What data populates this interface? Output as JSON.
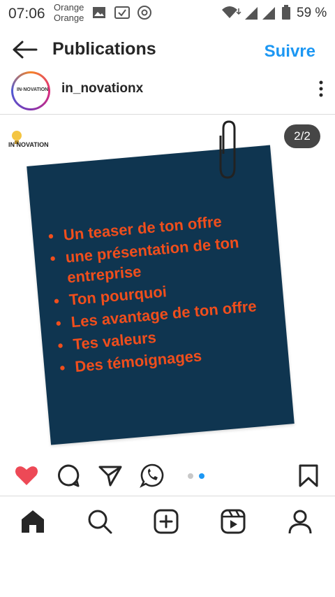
{
  "status_bar": {
    "time": "07:06",
    "carrier_line1": "Orange",
    "carrier_line2": "Orange",
    "battery": "59 %"
  },
  "header": {
    "title": "Publications",
    "follow_label": "Suivre"
  },
  "account": {
    "username": "in_novationx",
    "avatar_text": "IN·NOVATION"
  },
  "post": {
    "brand_text": "IN NOVATION",
    "page_indicator": "2/2",
    "items": [
      "Un teaser de ton offre",
      "une présentation de ton entreprise",
      "Ton pourquoi",
      "Les avantage de ton offre",
      "Tes valeurs",
      "Des témoignages"
    ]
  },
  "colors": {
    "accent": "#1c97f3",
    "card_bg": "#0f3550",
    "card_text": "#f04e1c",
    "like": "#ed4956"
  },
  "actions": [
    "heart-icon",
    "comment-icon",
    "share-icon",
    "whatsapp-icon",
    "bookmark-icon"
  ],
  "carousel": {
    "count": 2,
    "active": 2
  },
  "nav": [
    "home-icon",
    "search-icon",
    "create-icon",
    "reels-icon",
    "profile-icon"
  ]
}
